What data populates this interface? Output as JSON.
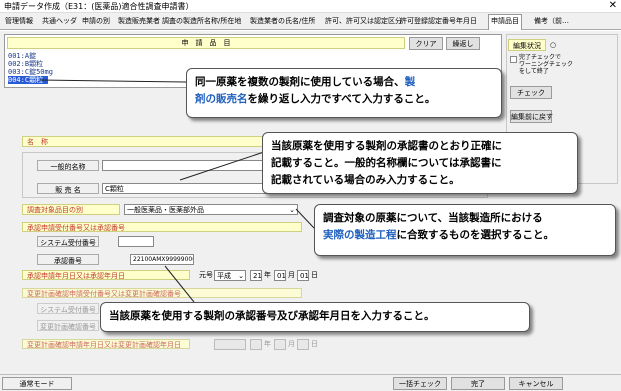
{
  "window": {
    "title": "申請データ作成（E31：(医薬品)適合性調査申請書）",
    "close": "✕"
  },
  "tabs": [
    "管理情報",
    "共通ヘッダ",
    "申請の別",
    "製造販売業者",
    "調査の製造所名称/所在地",
    "製造業者の氏名/住所",
    "許可、許可又は認定区分",
    "許可登録認定番号年月日",
    "申請品目",
    "備考（前…"
  ],
  "active_tab": "申請品目",
  "items_panel": {
    "header": "申　請　品　目",
    "clear_label": "クリア",
    "repeat_label": "繰返し",
    "list": [
      "001:A錠",
      "002:B顆粒",
      "003:C錠50mg",
      "004:C顆粒"
    ],
    "selected_index": 3
  },
  "side": {
    "edit_status_label": "編集状況",
    "edit_status_value": "○",
    "complete_label": "完了チェックで\nワーニングチェック\nをして終了",
    "check_label": "チェック",
    "revert_label": "編集前に戻す"
  },
  "form": {
    "name_label": "名　称",
    "generic_name_label": "一般的名称",
    "generic_name_value": "",
    "brand_name_label": "販 売 名",
    "brand_name_value": "C顆粒",
    "category_label": "調査対象品目の別",
    "category_value": "一般医薬品・医薬部外品",
    "approval_section_label": "承認申請受付番号又は承認番号",
    "system_no_label": "システム受付番号",
    "system_no_value": "",
    "approval_no_label": "承認番号",
    "approval_no_value": "22100AMX99999000",
    "approval_date_label": "承認申請年月日又は承認年月日",
    "era_label": "元号",
    "era_value": "平成",
    "year_value": "21",
    "year_unit": "年",
    "month_value": "01",
    "month_unit": "月",
    "day_value": "01",
    "day_unit": "日",
    "change_section_label": "変更計画確認申請受付番号又は変更計画確認番号",
    "change_system_label": "システム受付番号",
    "change_no_label": "変更計画確認番号",
    "change_date_label": "変更計画確認申請年月日又は変更計画確認年月日",
    "change_year_unit": "年",
    "change_month_unit": "月",
    "change_day_unit": "日"
  },
  "callouts": {
    "c1_a": "同一原薬を複数の製剤に使用している場合、",
    "c1_hl1": "製",
    "c1_hl2": "剤の販売名",
    "c1_b": "を繰り返し入力ですべて入力すること。",
    "c2_l1": "当該原薬を使用する製剤の承認書のとおり正確に",
    "c2_l2": "記載すること。一般的名称欄については承認書に",
    "c2_l3": "記載されている場合のみ入力すること。",
    "c3_l1": "調査対象の原薬について、当該製造所における",
    "c3_hl": "実際の製造工程",
    "c3_l2": "に合致するものを選択すること。",
    "c4": "当該原薬を使用する製剤の承認番号及び承認年月日を入力すること。"
  },
  "status": {
    "mode_label": "通常モード",
    "bulk_check_label": "一括チェック",
    "finish_label": "完了",
    "cancel_label": "キャンセル"
  }
}
